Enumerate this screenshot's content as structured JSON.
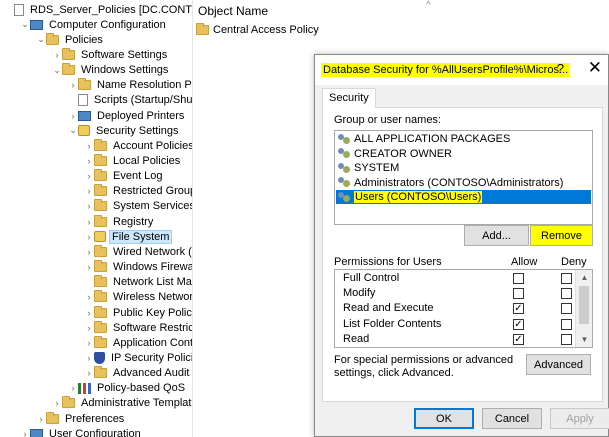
{
  "tree": {
    "items": [
      {
        "label": "RDS_Server_Policies [DC.CONTOSO.Co",
        "icon": "policy-doc-icon",
        "indent": 0,
        "toggle": ""
      },
      {
        "label": "Computer Configuration",
        "icon": "computer-icon",
        "indent": 1,
        "toggle": "v"
      },
      {
        "label": "Policies",
        "icon": "folder-icon",
        "indent": 2,
        "toggle": "v"
      },
      {
        "label": "Software Settings",
        "icon": "folder-icon",
        "indent": 3,
        "toggle": ">"
      },
      {
        "label": "Windows Settings",
        "icon": "folder-icon",
        "indent": 3,
        "toggle": "v"
      },
      {
        "label": "Name Resolution Policy",
        "icon": "folder-icon",
        "indent": 4,
        "toggle": ">"
      },
      {
        "label": "Scripts (Startup/Shutdo",
        "icon": "script-icon",
        "indent": 4,
        "toggle": ""
      },
      {
        "label": "Deployed Printers",
        "icon": "printer-icon",
        "indent": 4,
        "toggle": ">"
      },
      {
        "label": "Security Settings",
        "icon": "security-settings-icon",
        "indent": 4,
        "toggle": "v"
      },
      {
        "label": "Account Policies",
        "icon": "folder-icon",
        "indent": 5,
        "toggle": ">"
      },
      {
        "label": "Local Policies",
        "icon": "folder-icon",
        "indent": 5,
        "toggle": ">"
      },
      {
        "label": "Event Log",
        "icon": "folder-icon",
        "indent": 5,
        "toggle": ">"
      },
      {
        "label": "Restricted Groups",
        "icon": "folder-icon",
        "indent": 5,
        "toggle": ">"
      },
      {
        "label": "System Services",
        "icon": "folder-icon",
        "indent": 5,
        "toggle": ">"
      },
      {
        "label": "Registry",
        "icon": "folder-icon",
        "indent": 5,
        "toggle": ">"
      },
      {
        "label": "File System",
        "icon": "folder-lock-icon",
        "indent": 5,
        "toggle": ">",
        "selected": true
      },
      {
        "label": "Wired Network (IEEE",
        "icon": "folder-icon",
        "indent": 5,
        "toggle": ">"
      },
      {
        "label": "Windows Firewall w",
        "icon": "folder-icon",
        "indent": 5,
        "toggle": ">"
      },
      {
        "label": "Network List Manag",
        "icon": "folder-icon",
        "indent": 5,
        "toggle": ""
      },
      {
        "label": "Wireless Network (II",
        "icon": "folder-icon",
        "indent": 5,
        "toggle": ">"
      },
      {
        "label": "Public Key Policies",
        "icon": "folder-icon",
        "indent": 5,
        "toggle": ">"
      },
      {
        "label": "Software Restriction",
        "icon": "folder-icon",
        "indent": 5,
        "toggle": ">"
      },
      {
        "label": "Application Control",
        "icon": "folder-icon",
        "indent": 5,
        "toggle": ">"
      },
      {
        "label": "IP Security Policies",
        "icon": "shield-icon",
        "indent": 5,
        "toggle": ">"
      },
      {
        "label": "Advanced Audit Po",
        "icon": "folder-icon",
        "indent": 5,
        "toggle": ">"
      },
      {
        "label": "Policy-based QoS",
        "icon": "qos-chart-icon",
        "indent": 4,
        "toggle": ">"
      },
      {
        "label": "Administrative Templates:",
        "icon": "folder-icon",
        "indent": 3,
        "toggle": ">"
      },
      {
        "label": "Preferences",
        "icon": "folder-icon",
        "indent": 2,
        "toggle": ">"
      },
      {
        "label": "User Configuration",
        "icon": "user-config-icon",
        "indent": 1,
        "toggle": ">"
      }
    ]
  },
  "details": {
    "column_header": "Object Name",
    "rows": [
      {
        "label": "Central Access Policy",
        "icon": "folder-icon"
      }
    ]
  },
  "dialog": {
    "title": "Database Security for %AllUsersProfile%\\Micros...",
    "help": "?",
    "close": "✕",
    "tab": "Security",
    "group_label": "Group or user names:",
    "users": [
      {
        "name": "ALL APPLICATION PACKAGES",
        "selected": false
      },
      {
        "name": "CREATOR OWNER",
        "selected": false
      },
      {
        "name": "SYSTEM",
        "selected": false
      },
      {
        "name": "Administrators (CONTOSO\\Administrators)",
        "selected": false
      },
      {
        "name": "Users (CONTOSO\\Users)",
        "selected": true
      }
    ],
    "add_label": "Add...",
    "remove_label": "Remove",
    "permissions_label": "Permissions for Users",
    "allow_label": "Allow",
    "deny_label": "Deny",
    "permissions": [
      {
        "name": "Full Control",
        "allow": false,
        "deny": false
      },
      {
        "name": "Modify",
        "allow": false,
        "deny": false
      },
      {
        "name": "Read and Execute",
        "allow": true,
        "deny": false
      },
      {
        "name": "List Folder Contents",
        "allow": true,
        "deny": false
      },
      {
        "name": "Read",
        "allow": true,
        "deny": false
      }
    ],
    "special_text": "For special permissions or advanced settings, click Advanced.",
    "advanced_label": "Advanced",
    "ok_label": "OK",
    "cancel_label": "Cancel",
    "apply_label": "Apply"
  },
  "colors": {
    "highlight": "#ffff00",
    "selection": "#0078d7",
    "tree_selection": "#cce8ff"
  }
}
